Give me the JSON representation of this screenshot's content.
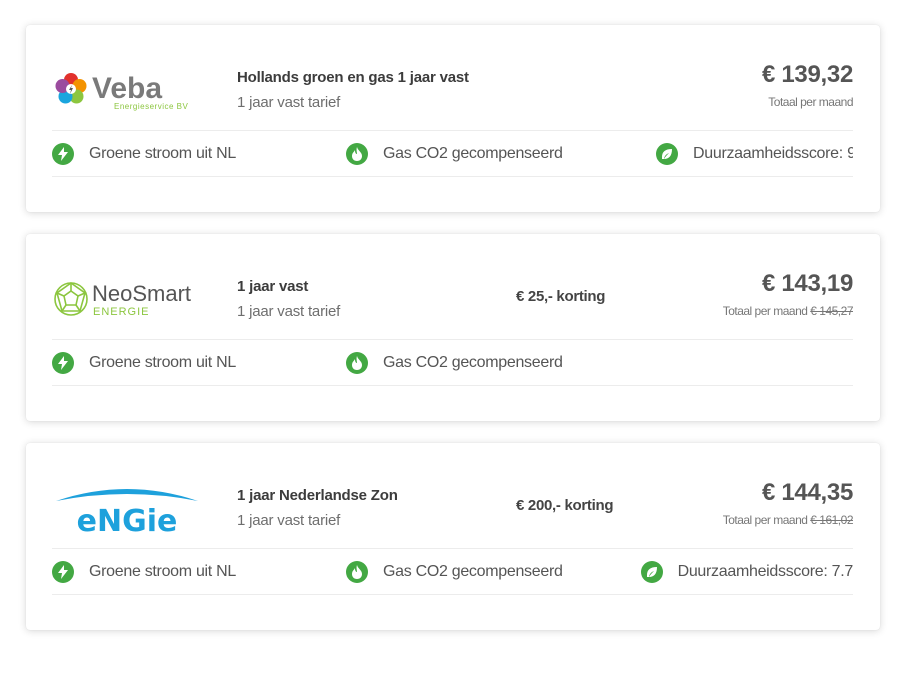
{
  "offers": [
    {
      "provider": "Veba",
      "provider_tagline": "Energieservice BV",
      "title": "Hollands groen en gas 1 jaar vast",
      "subtitle": "1 jaar vast tarief",
      "discount": "",
      "price": "€ 139,32",
      "price_label": "Totaal per maand",
      "old_price": "",
      "features": [
        "Groene stroom uit NL",
        "Gas CO2 gecompenseerd",
        "Duurzaamheidsscore: 9"
      ]
    },
    {
      "provider": "NeoSmart",
      "provider_tagline": "ENERGIE",
      "title": "1 jaar vast",
      "subtitle": "1 jaar vast tarief",
      "discount": "€ 25,- korting",
      "price": "€ 143,19",
      "price_label": "Totaal per maand",
      "old_price": "€ 145,27",
      "features": [
        "Groene stroom uit NL",
        "Gas CO2 gecompenseerd"
      ]
    },
    {
      "provider": "eNGie",
      "provider_tagline": "",
      "title": "1 jaar Nederlandse Zon",
      "subtitle": "1 jaar vast tarief",
      "discount": "€ 200,- korting",
      "price": "€ 144,35",
      "price_label": "Totaal per maand",
      "old_price": "€ 161,02",
      "features": [
        "Groene stroom uit NL",
        "Gas CO2 gecompenseerd",
        "Duurzaamheidsscore: 7.7"
      ]
    }
  ],
  "icons": {
    "feature_1": "lightning-icon",
    "feature_2": "flame-icon",
    "feature_3": "leaf-icon"
  },
  "colors": {
    "feature_icon_bg": "#43a843",
    "engie_blue": "#1ea1dc",
    "neosmart_green": "#8cc63f",
    "veba_text": "#7a7a7a"
  }
}
